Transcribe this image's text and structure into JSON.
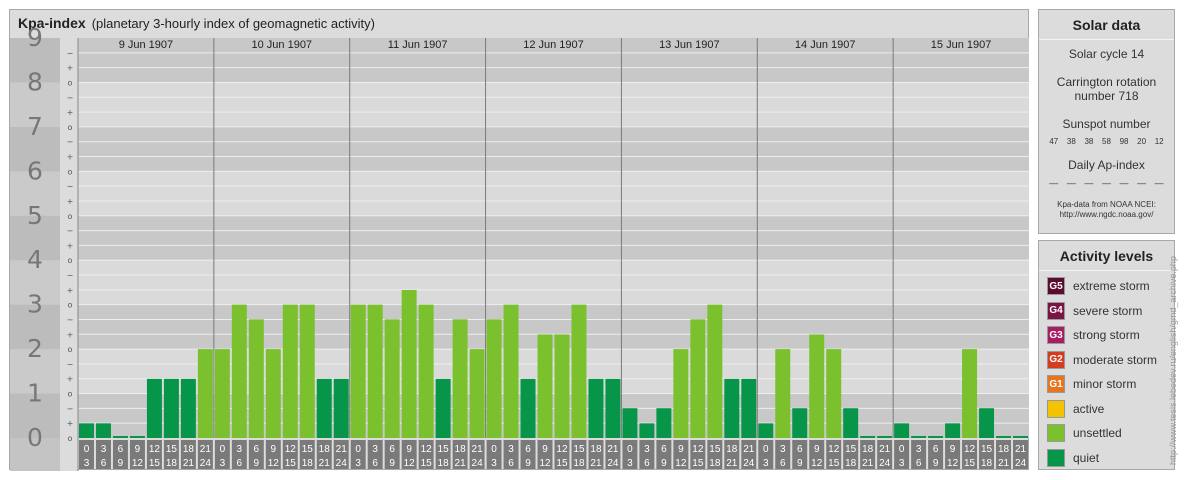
{
  "header": {
    "title": "Kpa-index",
    "subtitle": "(planetary 3-hourly index of geomagnetic activity)"
  },
  "chart_data": {
    "type": "bar",
    "title": "Kpa-index",
    "subtitle": "(planetary 3-hourly index of geomagnetic activity)",
    "ylim": [
      0,
      9
    ],
    "y_ticks": [
      "0",
      "1",
      "2",
      "3",
      "4",
      "5",
      "6",
      "7",
      "8",
      "9"
    ],
    "minor_ticks": [
      "+",
      "o",
      "−"
    ],
    "days": [
      "9 Jun 1907",
      "10 Jun 1907",
      "11 Jun 1907",
      "12 Jun 1907",
      "13 Jun 1907",
      "14 Jun 1907",
      "15 Jun 1907"
    ],
    "interval_top": [
      "0",
      "3",
      "6",
      "9",
      "12",
      "15",
      "18",
      "21"
    ],
    "interval_bottom": [
      "3",
      "6",
      "9",
      "12",
      "15",
      "18",
      "21",
      "24"
    ],
    "values": [
      [
        0.33,
        0.33,
        0.0,
        0.0,
        1.33,
        1.33,
        1.33,
        2.0
      ],
      [
        2.0,
        3.0,
        2.67,
        2.0,
        3.0,
        3.0,
        1.33,
        1.33
      ],
      [
        3.0,
        3.0,
        2.67,
        3.33,
        3.0,
        1.33,
        2.67,
        2.0
      ],
      [
        2.67,
        3.0,
        1.33,
        2.33,
        2.33,
        3.0,
        1.33,
        1.33
      ],
      [
        0.67,
        0.33,
        0.67,
        2.0,
        2.67,
        3.0,
        1.33,
        1.33
      ],
      [
        0.33,
        2.0,
        0.67,
        2.33,
        2.0,
        0.67,
        0.0,
        0.0
      ],
      [
        0.33,
        0.0,
        0.0,
        0.33,
        2.0,
        0.67,
        0.0,
        0.0
      ]
    ],
    "colors": {
      "quiet": "#079549",
      "unsettled": "#7ac12d",
      "active": "#f5c200"
    },
    "grid": true
  },
  "solar": {
    "heading": "Solar data",
    "cycle": "Solar cycle 14",
    "carrington_line1": "Carrington rotation",
    "carrington_line2": "number 718",
    "sunspot_heading": "Sunspot number",
    "sunspots": [
      "47",
      "38",
      "38",
      "58",
      "98",
      "20",
      "12"
    ],
    "ap_heading": "Daily Ap-index",
    "ap_values": [
      "—",
      "—",
      "—",
      "—",
      "—",
      "—",
      "—"
    ],
    "credit_line1": "Kpa-data from NOAA NCEI:",
    "credit_line2": "http://www.ngdc.noaa.gov/"
  },
  "legend": {
    "heading": "Activity levels",
    "items": [
      {
        "badge": "G5",
        "label": "extreme storm",
        "color": "#5c0d2e"
      },
      {
        "badge": "G4",
        "label": "severe storm",
        "color": "#7a1545"
      },
      {
        "badge": "G3",
        "label": "strong storm",
        "color": "#a71e63"
      },
      {
        "badge": "G2",
        "label": "moderate storm",
        "color": "#d53b1e"
      },
      {
        "badge": "G1",
        "label": "minor storm",
        "color": "#e8741e"
      },
      {
        "badge": "",
        "label": "active",
        "color": "#f5c200"
      },
      {
        "badge": "",
        "label": "unsettled",
        "color": "#7ac12d"
      },
      {
        "badge": "",
        "label": "quiet",
        "color": "#079549"
      }
    ]
  },
  "watermark": "http://www.tesis.lebedev.ru/english/gmd_archive.php"
}
